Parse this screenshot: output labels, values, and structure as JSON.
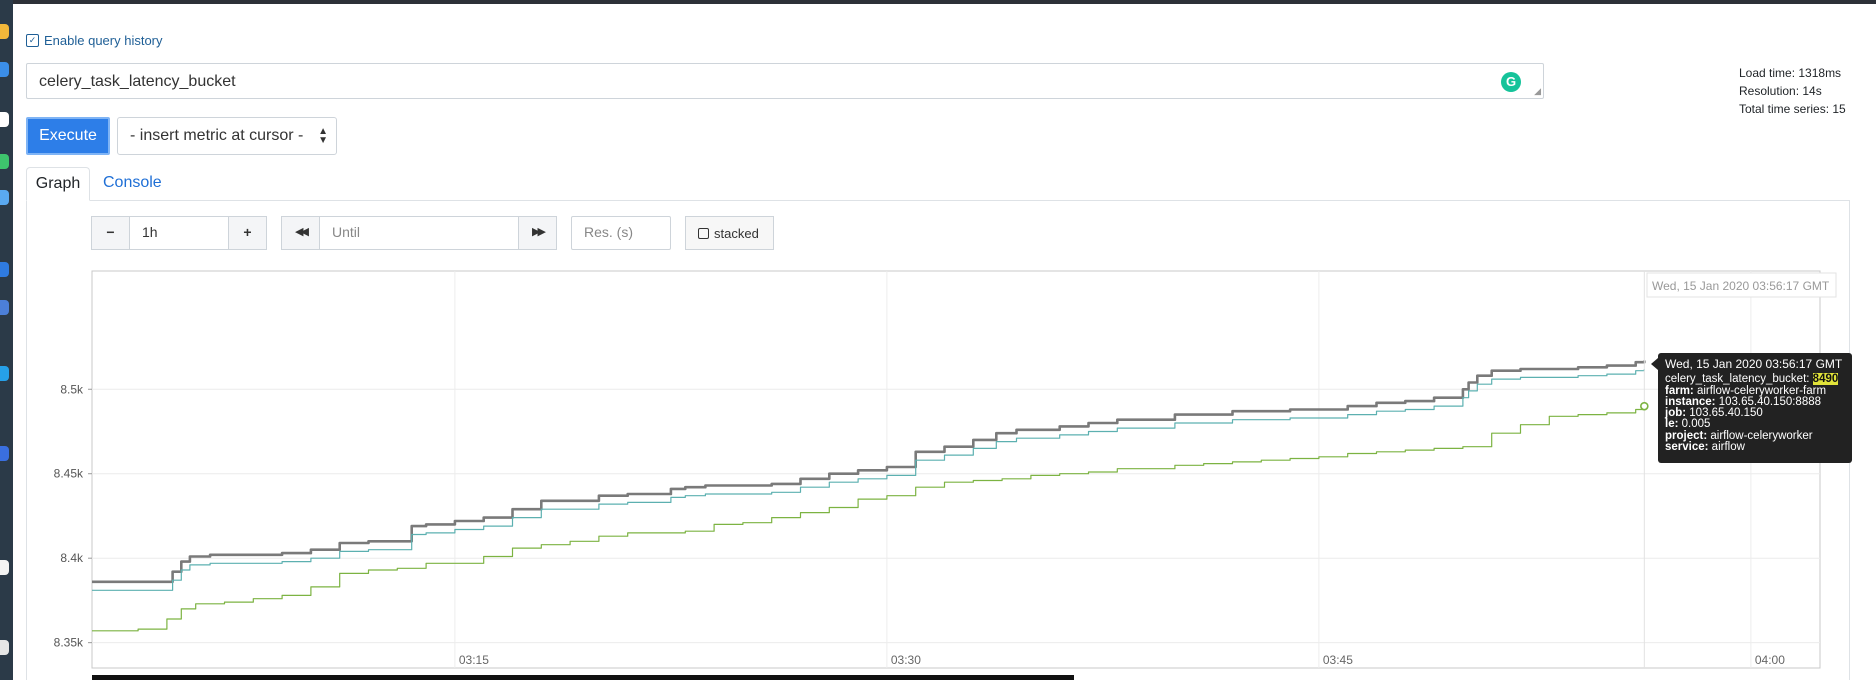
{
  "history": {
    "label": "Enable query history"
  },
  "query": {
    "value": "celery_task_latency_bucket"
  },
  "stats": {
    "load_time": "Load time: 1318ms",
    "resolution": "Resolution: 14s",
    "total_series": "Total time series: 15"
  },
  "buttons": {
    "execute": "Execute",
    "insert_metric": "- insert metric at cursor -"
  },
  "tabs": {
    "graph": "Graph",
    "console": "Console"
  },
  "controls": {
    "minus": "−",
    "range": "1h",
    "plus": "+",
    "back": "◀◀",
    "until_placeholder": "Until",
    "forward": "▶▶",
    "res_placeholder": "Res. (s)",
    "stacked": "stacked"
  },
  "hover_time": "Wed, 15 Jan 2020 03:56:17 GMT",
  "tooltip": {
    "time": "Wed, 15 Jan 2020 03:56:17 GMT",
    "metric_key": "celery_task_latency_bucket:",
    "metric_value": "8490",
    "labels": [
      {
        "key": "farm:",
        "value": "airflow-celeryworker-farm"
      },
      {
        "key": "instance:",
        "value": "103.65.40.150:8888"
      },
      {
        "key": "job:",
        "value": "103.65.40.150"
      },
      {
        "key": "le:",
        "value": "0.005"
      },
      {
        "key": "project:",
        "value": "airflow-celeryworker"
      },
      {
        "key": "service:",
        "value": "airflow"
      }
    ]
  },
  "chart_data": {
    "type": "line",
    "x_ticks": [
      "03:15",
      "03:30",
      "03:45",
      "04:00"
    ],
    "y_ticks": [
      "8.35k",
      "8.4k",
      "8.45k",
      "8.5k"
    ],
    "ylim": [
      8335,
      8570
    ],
    "xlim_minutes": [
      2.4,
      62.4
    ],
    "grid": true,
    "series": [
      {
        "color": "#7a7a7a",
        "stroke_width": 2.6,
        "x": [
          2.4,
          5.0,
          5.2,
          5.5,
          5.8,
          6.5,
          7.0,
          9.0,
          10.0,
          11.0,
          12.0,
          13.5,
          14.0,
          15.0,
          16.0,
          17.0,
          18.0,
          19.0,
          20.0,
          21.0,
          22.5,
          23.0,
          23.7,
          24.5,
          26.0,
          27.0,
          28.0,
          29.0,
          30.0,
          31.0,
          32.0,
          33.0,
          33.8,
          34.5,
          36.0,
          37.0,
          38.0,
          39.0,
          40.0,
          42.0,
          44.0,
          46.0,
          47.0,
          48.0,
          49.0,
          50.0,
          50.2,
          50.5,
          51.0,
          52.0,
          53.0,
          54.0,
          55.0,
          56.0,
          56.3
        ],
        "y": [
          8386,
          8386,
          8392,
          8398,
          8401,
          8402,
          8402,
          8403,
          8405,
          8409,
          8410,
          8419,
          8420,
          8422,
          8424,
          8429,
          8434,
          8434,
          8437,
          8438,
          8441,
          8442,
          8443,
          8443,
          8444,
          8447,
          8450,
          8452,
          8454,
          8463,
          8466,
          8470,
          8474,
          8476,
          8478,
          8480,
          8482,
          8482,
          8485,
          8487,
          8488,
          8490,
          8492,
          8493,
          8495,
          8500,
          8504,
          8508,
          8511,
          8512,
          8512,
          8513,
          8514,
          8516,
          8517
        ]
      },
      {
        "color": "#5cb0b0",
        "stroke_width": 1.2,
        "x": [
          2.4,
          5.0,
          5.2,
          5.5,
          5.8,
          6.5,
          7.0,
          9.0,
          10.0,
          11.0,
          12.0,
          13.5,
          14.0,
          15.0,
          16.0,
          17.0,
          18.0,
          19.0,
          20.0,
          21.0,
          22.5,
          23.0,
          23.7,
          24.5,
          26.0,
          27.0,
          28.0,
          29.0,
          30.0,
          31.0,
          32.0,
          33.0,
          33.8,
          34.5,
          36.0,
          37.0,
          38.0,
          39.0,
          40.0,
          42.0,
          44.0,
          46.0,
          47.0,
          48.0,
          49.0,
          50.0,
          50.2,
          50.5,
          51.0,
          52.0,
          53.0,
          54.0,
          55.0,
          56.0,
          56.3
        ],
        "y": [
          8381,
          8381,
          8387,
          8393,
          8396,
          8397,
          8397,
          8398,
          8400,
          8404,
          8405,
          8414,
          8415,
          8417,
          8419,
          8424,
          8429,
          8429,
          8432,
          8433,
          8436,
          8437,
          8438,
          8438,
          8439,
          8442,
          8445,
          8447,
          8449,
          8458,
          8461,
          8465,
          8469,
          8471,
          8473,
          8475,
          8477,
          8477,
          8480,
          8482,
          8483,
          8485,
          8487,
          8488,
          8490,
          8495,
          8499,
          8503,
          8506,
          8507,
          8507,
          8508,
          8509,
          8511,
          8512
        ]
      },
      {
        "color": "#7cb342",
        "stroke_width": 1.2,
        "x": [
          2.4,
          4.0,
          5.0,
          5.5,
          6.0,
          7.0,
          8.0,
          9.0,
          10.0,
          11.0,
          12.0,
          13.0,
          14.0,
          15.0,
          16.0,
          17.0,
          18.0,
          19.0,
          20.0,
          21.0,
          22.0,
          23.0,
          24.0,
          25.0,
          26.0,
          27.0,
          28.0,
          29.0,
          30.0,
          31.0,
          32.0,
          33.0,
          34.0,
          35.0,
          36.0,
          37.0,
          38.0,
          39.0,
          40.0,
          41.0,
          42.0,
          43.0,
          44.0,
          45.0,
          46.0,
          47.0,
          48.0,
          49.0,
          50.0,
          51.0,
          52.0,
          53.0,
          54.0,
          55.0,
          56.0,
          56.3
        ],
        "y": [
          8357,
          8358,
          8364,
          8370,
          8373,
          8374,
          8376,
          8378,
          8383,
          8391,
          8393,
          8394,
          8397,
          8397,
          8401,
          8406,
          8408,
          8410,
          8413,
          8415,
          8415,
          8416,
          8420,
          8421,
          8424,
          8427,
          8430,
          8435,
          8437,
          8442,
          8445,
          8446,
          8447,
          8449,
          8450,
          8451,
          8453,
          8453,
          8455,
          8456,
          8457,
          8458,
          8459,
          8460,
          8462,
          8463,
          8464,
          8465,
          8466,
          8474,
          8479,
          8484,
          8485,
          8486,
          8488,
          8490
        ]
      }
    ]
  }
}
